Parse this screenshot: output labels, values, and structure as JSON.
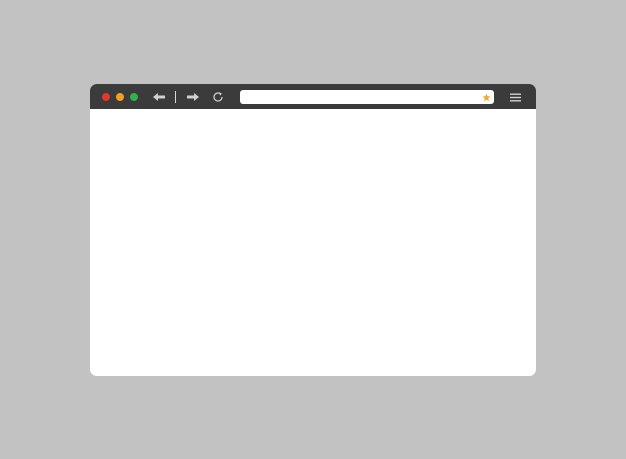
{
  "window": {
    "background_color": "#c2c2c2",
    "frame_color": "#3b3b3b",
    "content_color": "#ffffff"
  },
  "traffic_lights": [
    {
      "name": "close",
      "color": "#e0382b"
    },
    {
      "name": "minimize",
      "color": "#f0a020"
    },
    {
      "name": "maximize",
      "color": "#2fb34a"
    }
  ],
  "toolbar": {
    "back_icon": "arrow-left-icon",
    "forward_icon": "arrow-right-icon",
    "reload_icon": "reload-icon",
    "menu_icon": "hamburger-menu-icon",
    "icon_color": "#d0d0d0"
  },
  "address_bar": {
    "value": "",
    "placeholder": "",
    "bookmark_icon": "star-icon",
    "bookmark_color": "#f5a623"
  },
  "page": {
    "content": ""
  }
}
